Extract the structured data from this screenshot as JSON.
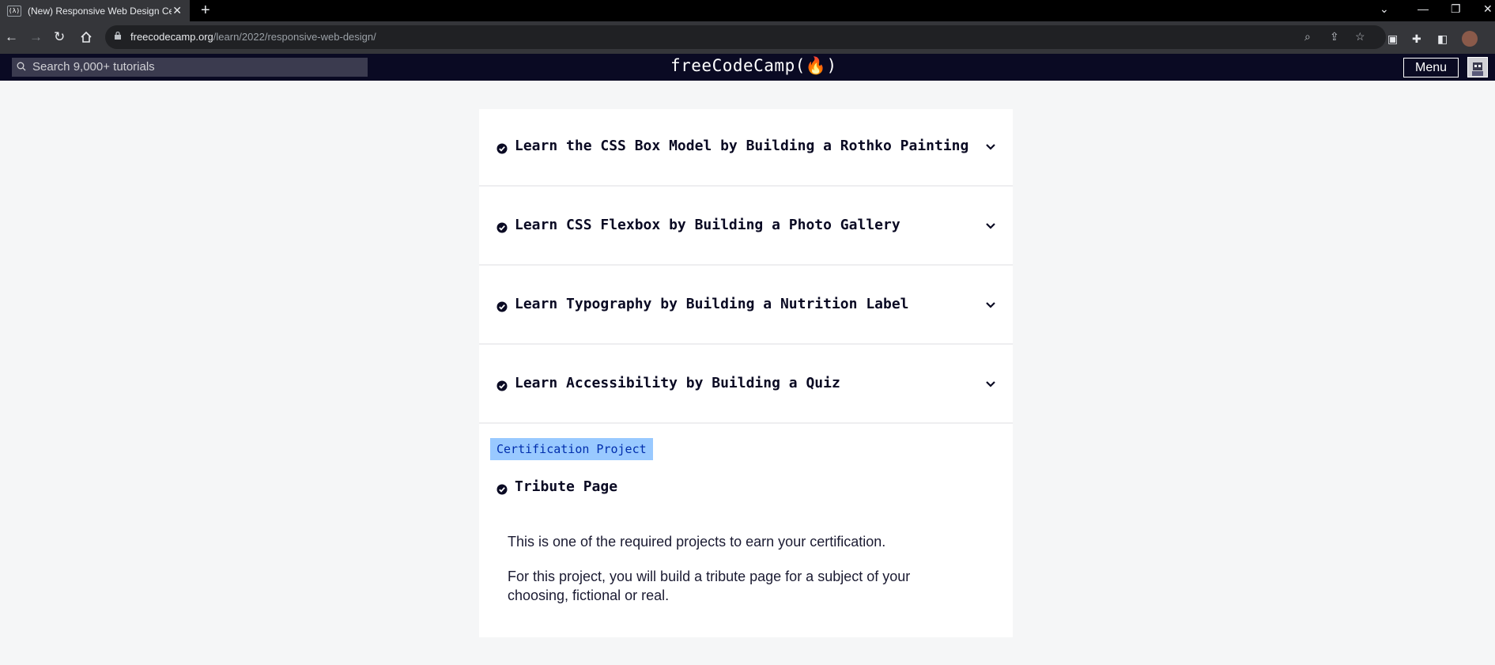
{
  "browser": {
    "tab_title": "(New) Responsive Web Design Ce",
    "favicon_text": "(λ)",
    "url_host": "freecodecamp.org",
    "url_path": "/learn/2022/responsive-web-design/"
  },
  "nav": {
    "search_placeholder": "Search 9,000+ tutorials",
    "logo": "freeCodeCamp(🔥)",
    "menu_label": "Menu"
  },
  "blocks": [
    {
      "title": "Learn the CSS Box Model by Building a Rothko Painting",
      "completed": true
    },
    {
      "title": "Learn CSS Flexbox by Building a Photo Gallery",
      "completed": true
    },
    {
      "title": "Learn Typography by Building a Nutrition Label",
      "completed": true
    },
    {
      "title": "Learn Accessibility by Building a Quiz",
      "completed": true
    }
  ],
  "certification": {
    "tag": "Certification Project",
    "project_title": "Tribute Page",
    "description_1": "This is one of the required projects to earn your certification.",
    "description_2": "For this project, you will build a tribute page for a subject of your choosing, fictional or real."
  },
  "colors": {
    "nav_bg": "#0a0a23",
    "cert_tag_bg": "#99c9ff",
    "page_bg": "#f5f6f7"
  }
}
